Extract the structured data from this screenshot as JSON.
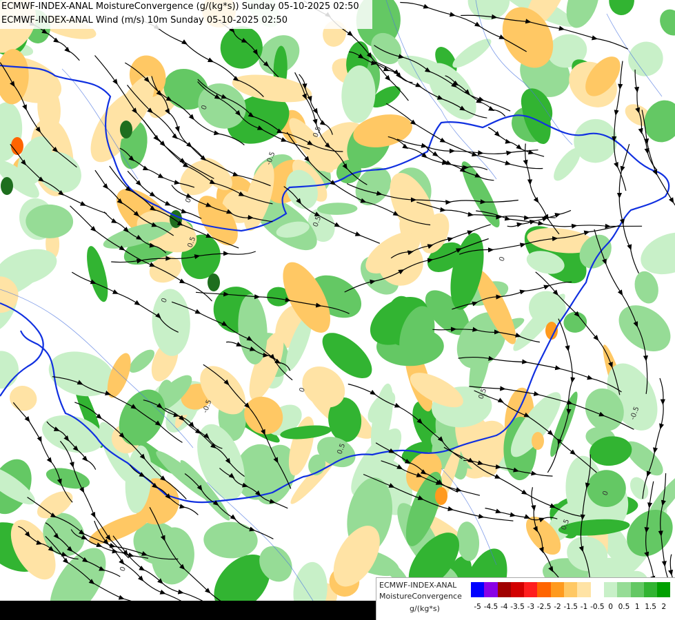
{
  "title": {
    "line1": "ECMWF-INDEX-ANAL MoistureConvergence (g/(kg*s)) Sunday 05-10-2025 02:50",
    "line2": "ECMWF-INDEX-ANAL Wind (m/s) 10m Sunday 05-10-2025 02:50"
  },
  "legend": {
    "model": "ECMWF-INDEX-ANAL",
    "variable": "MoistureConvergence",
    "unit": "g/(kg*s)",
    "colors": [
      "#0000ff",
      "#8a00e6",
      "#a00000",
      "#d20000",
      "#ff1e1e",
      "#ff6400",
      "#ff9a1e",
      "#ffc864",
      "#ffe3a5",
      "#ffffff",
      "#c8f0c8",
      "#96dc96",
      "#64c864",
      "#32b432",
      "#00a000"
    ],
    "ticks": [
      "-5",
      "-4.5",
      "-4",
      "-3.5",
      "-3",
      "-2.5",
      "-2",
      "-1.5",
      "-1",
      "-0.5",
      "0",
      "0.5",
      "1",
      "1.5",
      "2"
    ]
  },
  "map": {
    "contour_labels": [
      "0",
      "0.5",
      "-0.5",
      "0",
      "0.5",
      "0",
      "0.5",
      "0",
      "-0.5",
      "0.5",
      "0",
      "0.5",
      "-0.5",
      "0",
      "0.5",
      "0"
    ]
  }
}
